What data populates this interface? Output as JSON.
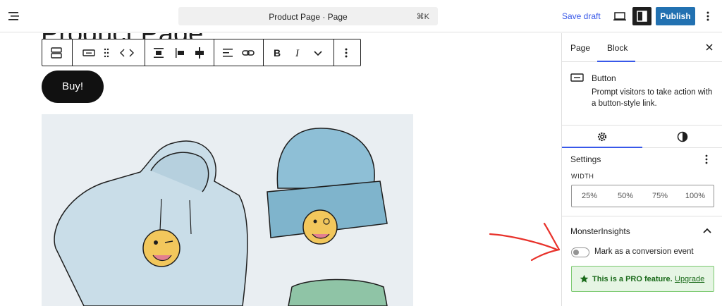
{
  "topbar": {
    "document_title": "Product Page · Page",
    "shortcut": "⌘K",
    "save_draft": "Save draft",
    "publish": "Publish",
    "icons": {
      "menu": "hamburger-icon",
      "view": "laptop-icon",
      "settings": "sidebar-icon",
      "options": "kebab-icon"
    }
  },
  "canvas": {
    "page_title": "Product Page",
    "button_text": "Buy!",
    "image_subject": "hoodie and beanie with winking emoji"
  },
  "sidebar": {
    "tabs": [
      {
        "label": "Page"
      },
      {
        "label": "Block"
      }
    ],
    "active_tab": "Block",
    "block": {
      "name": "Button",
      "description": "Prompt visitors to take action with a button-style link."
    },
    "subtabs": [
      {
        "icon": "gear-icon"
      },
      {
        "icon": "contrast-icon"
      }
    ],
    "settings": {
      "title": "Settings",
      "width_label": "WIDTH",
      "width_options": [
        "25%",
        "50%",
        "75%",
        "100%"
      ]
    },
    "monsterinsights": {
      "title": "MonsterInsights",
      "toggle_label": "Mark as a conversion event",
      "toggle_on": false,
      "pro_text": "This is a PRO feature.",
      "upgrade": "Upgrade"
    }
  },
  "colors": {
    "accent": "#3858e9",
    "publish": "#2271b1",
    "annotation_arrow": "#e8322b",
    "pro_bg": "#e6f5e4",
    "pro_border": "#7bc96f"
  }
}
